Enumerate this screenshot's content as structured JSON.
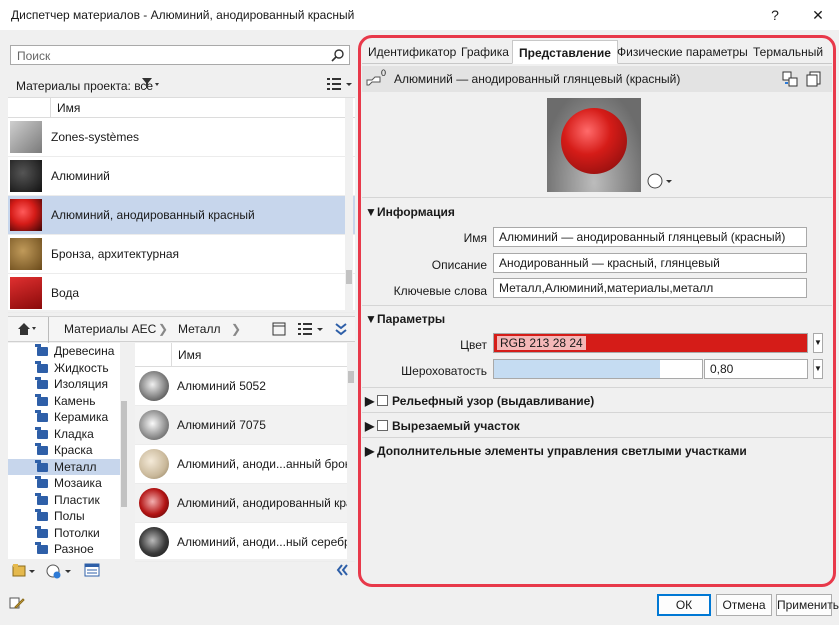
{
  "window": {
    "title": "Диспетчер материалов - Алюминий, анодированный красный",
    "help_label": "?",
    "close_label": "✕"
  },
  "left": {
    "search": {
      "placeholder": "Поиск"
    },
    "project_filter_label": "Материалы проекта: все",
    "project_list": {
      "column_header": "Имя",
      "items": [
        {
          "name": "Zones-systèmes",
          "swatch": "#8a8a8a"
        },
        {
          "name": "Алюминий",
          "swatch": "#2b2b2b"
        },
        {
          "name": "Алюминий, анодированный красный",
          "swatch": "#d51c18",
          "selected": true
        },
        {
          "name": "Бронза, архитектурная",
          "swatch": "#7a5a2a"
        },
        {
          "name": "Вода",
          "swatch": "#c41515"
        }
      ]
    },
    "breadcrumb": [
      "Материалы AEC",
      "Металл"
    ],
    "library_tree": {
      "items": [
        {
          "label": "Древесина"
        },
        {
          "label": "Жидкость"
        },
        {
          "label": "Изоляция"
        },
        {
          "label": "Камень"
        },
        {
          "label": "Керамика"
        },
        {
          "label": "Кладка"
        },
        {
          "label": "Краска"
        },
        {
          "label": "Металл",
          "selected": true
        },
        {
          "label": "Мозаика"
        },
        {
          "label": "Пластик"
        },
        {
          "label": "Полы"
        },
        {
          "label": "Потолки"
        },
        {
          "label": "Разное"
        }
      ]
    },
    "library_list": {
      "column_header": "Имя",
      "items": [
        {
          "name": "Алюминий 5052",
          "swatch": "#9a9a9a"
        },
        {
          "name": "Алюминий 7075",
          "swatch": "#a6a6a6"
        },
        {
          "name": "Алюминий, аноди...анный бронз",
          "swatch": "#c9b89a"
        },
        {
          "name": "Алюминий, анодированный крас",
          "swatch": "#b31414"
        },
        {
          "name": "Алюминий, аноди...ный серебри",
          "swatch": "#3a3a3a"
        }
      ]
    }
  },
  "right": {
    "tabs": [
      {
        "label": "Идентификатор"
      },
      {
        "label": "Графика"
      },
      {
        "label": "Представление",
        "active": true
      },
      {
        "label": "Физические параметры"
      },
      {
        "label": "Термальный"
      }
    ],
    "asset": {
      "name": "Алюминий — анодированный глянцевый (красный)",
      "usage_count": "0"
    },
    "info": {
      "title": "Информация",
      "name_label": "Имя",
      "name_value": "Алюминий — анодированный глянцевый (красный)",
      "desc_label": "Описание",
      "desc_value": "Анодированный — красный, глянцевый",
      "keywords_label": "Ключевые слова",
      "keywords_value": "Металл,Алюминий,материалы,металл"
    },
    "params": {
      "title": "Параметры",
      "color_label": "Цвет",
      "color_value": "RGB 213 28 24",
      "color_hex": "#d51c18",
      "roughness_label": "Шероховатость",
      "roughness_value": "0,80",
      "roughness_fraction": 0.8
    },
    "collapsed_sections": [
      {
        "label": "Рельефный узор (выдавливание)",
        "checkbox": true
      },
      {
        "label": "Вырезаемый участок",
        "checkbox": true
      },
      {
        "label": "Дополнительные элементы управления светлыми участками",
        "checkbox": false
      }
    ]
  },
  "footer": {
    "ok_label": "ОК",
    "cancel_label": "Отмена",
    "apply_label": "Применить"
  },
  "colors": {
    "highlight": "#e8394a",
    "selection": "#c7d6ec"
  }
}
